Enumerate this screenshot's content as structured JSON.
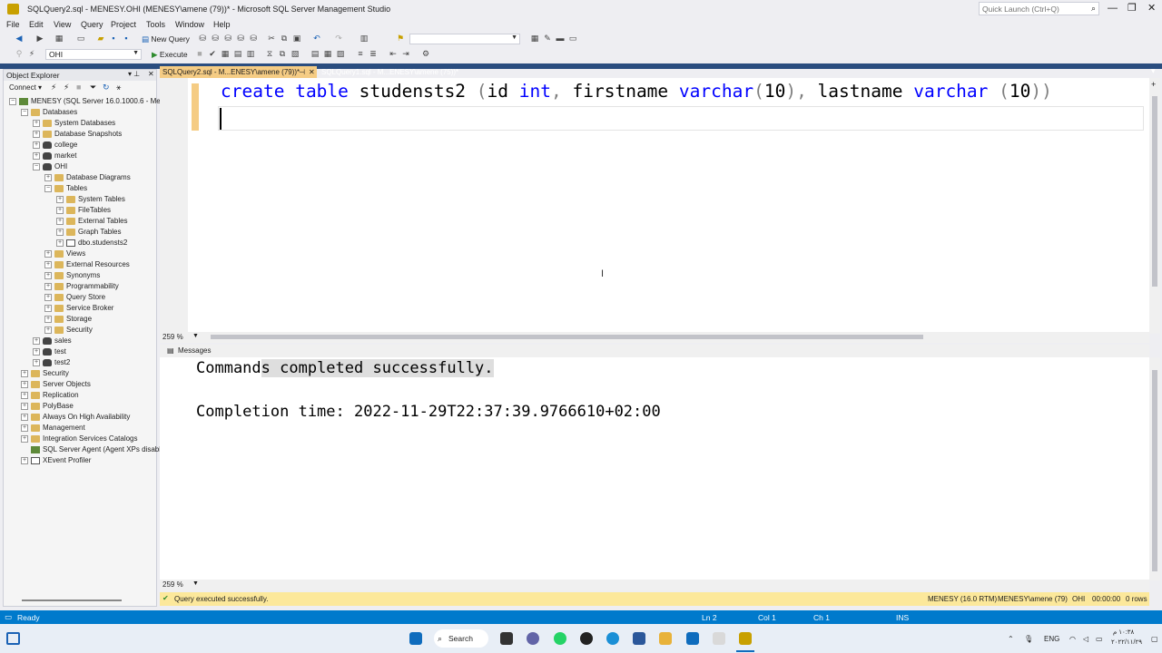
{
  "window": {
    "title": "SQLQuery2.sql - MENESY.OHI (MENESY\\amene (79))* - Microsoft SQL Server Management Studio",
    "quick_launch_placeholder": "Quick Launch (Ctrl+Q)"
  },
  "menu": [
    "File",
    "Edit",
    "View",
    "Query",
    "Project",
    "Tools",
    "Window",
    "Help"
  ],
  "toolbar": {
    "new_query": "New Query",
    "database": "OHI",
    "execute": "Execute"
  },
  "object_explorer": {
    "title": "Object Explorer",
    "connect": "Connect",
    "server": "MENESY (SQL Server 16.0.1000.6 - Men",
    "nodes": [
      {
        "label": "Databases",
        "depth": 1,
        "expander": "−",
        "icon": "folder"
      },
      {
        "label": "System Databases",
        "depth": 2,
        "expander": "+",
        "icon": "folder"
      },
      {
        "label": "Database Snapshots",
        "depth": 2,
        "expander": "+",
        "icon": "folder"
      },
      {
        "label": "college",
        "depth": 2,
        "expander": "+",
        "icon": "db"
      },
      {
        "label": "market",
        "depth": 2,
        "expander": "+",
        "icon": "db"
      },
      {
        "label": "OHI",
        "depth": 2,
        "expander": "−",
        "icon": "db"
      },
      {
        "label": "Database Diagrams",
        "depth": 3,
        "expander": "+",
        "icon": "folder"
      },
      {
        "label": "Tables",
        "depth": 3,
        "expander": "−",
        "icon": "folder"
      },
      {
        "label": "System Tables",
        "depth": 4,
        "expander": "+",
        "icon": "folder"
      },
      {
        "label": "FileTables",
        "depth": 4,
        "expander": "+",
        "icon": "folder"
      },
      {
        "label": "External Tables",
        "depth": 4,
        "expander": "+",
        "icon": "folder"
      },
      {
        "label": "Graph Tables",
        "depth": 4,
        "expander": "+",
        "icon": "folder"
      },
      {
        "label": "dbo.studensts2",
        "depth": 4,
        "expander": "+",
        "icon": "table"
      },
      {
        "label": "Views",
        "depth": 3,
        "expander": "+",
        "icon": "folder"
      },
      {
        "label": "External Resources",
        "depth": 3,
        "expander": "+",
        "icon": "folder"
      },
      {
        "label": "Synonyms",
        "depth": 3,
        "expander": "+",
        "icon": "folder"
      },
      {
        "label": "Programmability",
        "depth": 3,
        "expander": "+",
        "icon": "folder"
      },
      {
        "label": "Query Store",
        "depth": 3,
        "expander": "+",
        "icon": "folder"
      },
      {
        "label": "Service Broker",
        "depth": 3,
        "expander": "+",
        "icon": "folder"
      },
      {
        "label": "Storage",
        "depth": 3,
        "expander": "+",
        "icon": "folder"
      },
      {
        "label": "Security",
        "depth": 3,
        "expander": "+",
        "icon": "folder"
      },
      {
        "label": "sales",
        "depth": 2,
        "expander": "+",
        "icon": "db"
      },
      {
        "label": "test",
        "depth": 2,
        "expander": "+",
        "icon": "db"
      },
      {
        "label": "test2",
        "depth": 2,
        "expander": "+",
        "icon": "db"
      },
      {
        "label": "Security",
        "depth": 1,
        "expander": "+",
        "icon": "folder"
      },
      {
        "label": "Server Objects",
        "depth": 1,
        "expander": "+",
        "icon": "folder"
      },
      {
        "label": "Replication",
        "depth": 1,
        "expander": "+",
        "icon": "folder"
      },
      {
        "label": "PolyBase",
        "depth": 1,
        "expander": "+",
        "icon": "folder"
      },
      {
        "label": "Always On High Availability",
        "depth": 1,
        "expander": "+",
        "icon": "folder"
      },
      {
        "label": "Management",
        "depth": 1,
        "expander": "+",
        "icon": "folder"
      },
      {
        "label": "Integration Services Catalogs",
        "depth": 1,
        "expander": "+",
        "icon": "folder"
      },
      {
        "label": "SQL Server Agent (Agent XPs disabl",
        "depth": 1,
        "expander": "",
        "icon": "agent"
      },
      {
        "label": "XEvent Profiler",
        "depth": 1,
        "expander": "+",
        "icon": "xevent"
      }
    ]
  },
  "tabs": [
    {
      "label": "SQLQuery2.sql - M...ENESY\\amene (79))*",
      "active": true
    },
    {
      "label": "SQLQuery1.sql - M...ENESY\\amene (75))*",
      "active": false
    }
  ],
  "editor": {
    "tokens": [
      {
        "t": "create",
        "c": "kw"
      },
      {
        "t": " "
      },
      {
        "t": "table",
        "c": "kw"
      },
      {
        "t": " studensts2 "
      },
      {
        "t": "(",
        "c": "gray"
      },
      {
        "t": "id "
      },
      {
        "t": "int",
        "c": "kw"
      },
      {
        "t": ",",
        "c": "gray"
      },
      {
        "t": " firstname "
      },
      {
        "t": "varchar",
        "c": "kw"
      },
      {
        "t": "(",
        "c": "gray"
      },
      {
        "t": "10"
      },
      {
        "t": "),",
        "c": "gray"
      },
      {
        "t": " lastname "
      },
      {
        "t": "varchar",
        "c": "kw"
      },
      {
        "t": " "
      },
      {
        "t": "(",
        "c": "gray"
      },
      {
        "t": "10"
      },
      {
        "t": "))",
        "c": "gray"
      }
    ],
    "zoom": "259 %"
  },
  "results": {
    "tab": "Messages",
    "line1_a": "Command",
    "line1_b": "s completed successfully.",
    "line2": "Completion time: 2022-11-29T22:37:39.9766610+02:00",
    "zoom": "259 %"
  },
  "query_status": {
    "message": "Query executed successfully.",
    "server": "MENESY (16.0 RTM)",
    "user": "MENESY\\amene (79)",
    "db": "OHI",
    "time": "00:00:00",
    "rows": "0 rows"
  },
  "statusbar": {
    "ready": "Ready",
    "ln": "Ln 2",
    "col": "Col 1",
    "ch": "Ch 1",
    "ins": "INS"
  },
  "taskbar": {
    "search": "Search",
    "lang": "ENG",
    "time": "١٠:٣٨ م",
    "date": "٢٠٢٢/١١/٢٩"
  },
  "colors": {
    "accent": "#007acc",
    "tab_active": "#f5cc84",
    "status_query": "#fce89b",
    "keyword": "#0000ff"
  }
}
